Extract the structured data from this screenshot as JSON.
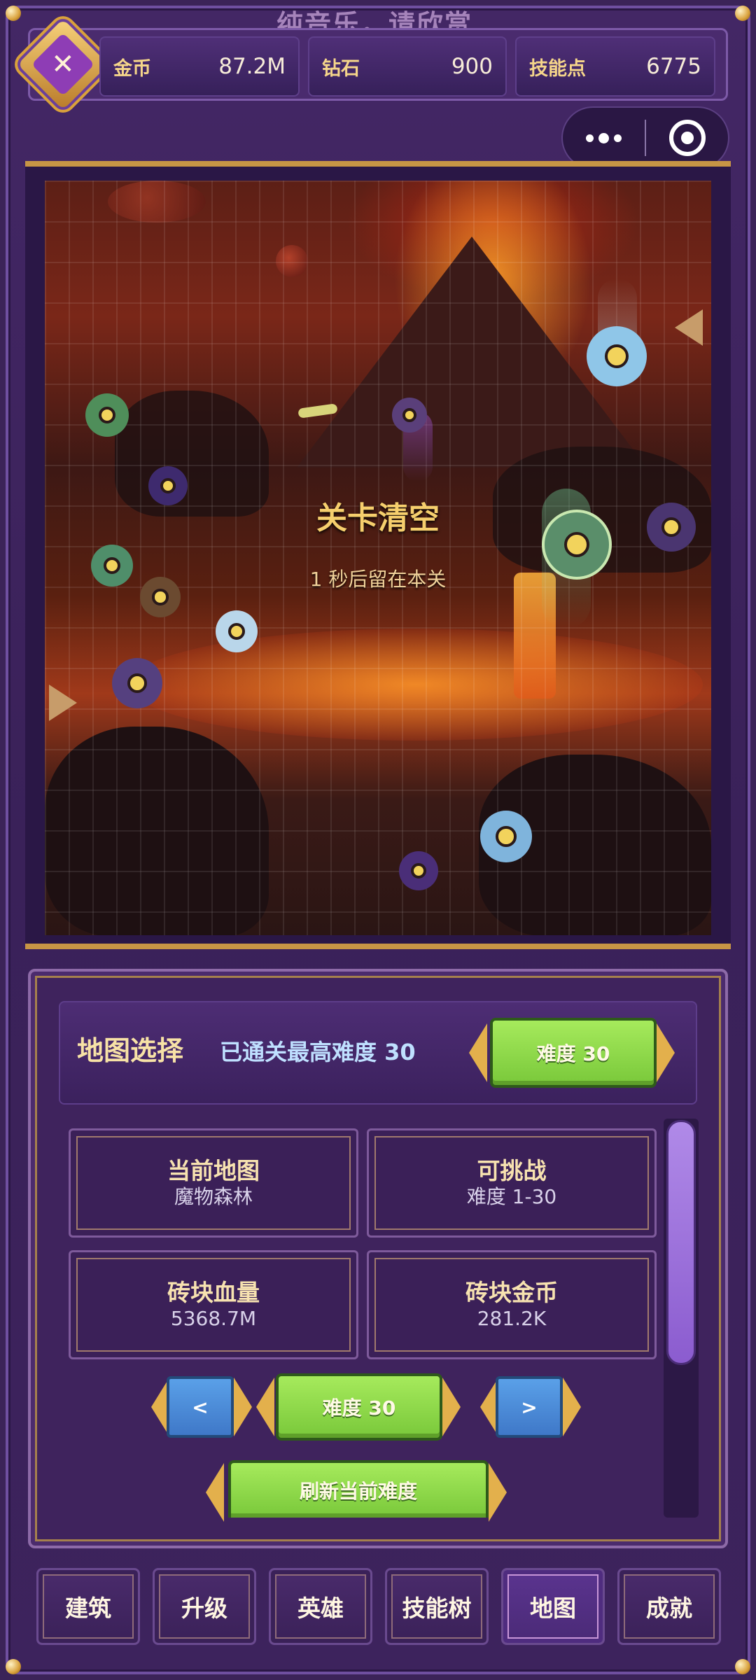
{
  "banner": {
    "music_text": "纯音乐，请欣赏"
  },
  "resources": [
    {
      "label": "金币",
      "value": "87.2M"
    },
    {
      "label": "钻石",
      "value": "900"
    },
    {
      "label": "技能点",
      "value": "6775"
    }
  ],
  "board": {
    "clear_title": "关卡清空",
    "stay_text": "1 秒后留在本关"
  },
  "map_panel": {
    "title": "地图选择",
    "best_label": "已通关最高难度 30",
    "difficulty_button": "难度 30"
  },
  "info_cards": [
    {
      "title": "当前地图",
      "value": "魔物森林"
    },
    {
      "title": "可挑战",
      "value": "难度 1-30"
    },
    {
      "title": "砖块血量",
      "value": "5368.7M"
    },
    {
      "title": "砖块金币",
      "value": "281.2K"
    }
  ],
  "difficulty_selector": {
    "prev_label": "<",
    "current_label": "难度 30",
    "next_label": ">"
  },
  "refresh_button": "刷新当前难度",
  "nav": [
    {
      "label": "建筑",
      "active": false
    },
    {
      "label": "升级",
      "active": false
    },
    {
      "label": "英雄",
      "active": false
    },
    {
      "label": "技能树",
      "active": false
    },
    {
      "label": "地图",
      "active": true
    },
    {
      "label": "成就",
      "active": false
    }
  ],
  "colors": {
    "background": "#3b2358",
    "gold_text": "#f6cf6d",
    "green_button": "#8fd84a",
    "blue_button": "#4d8ed8",
    "lava": "#e05a1a"
  }
}
